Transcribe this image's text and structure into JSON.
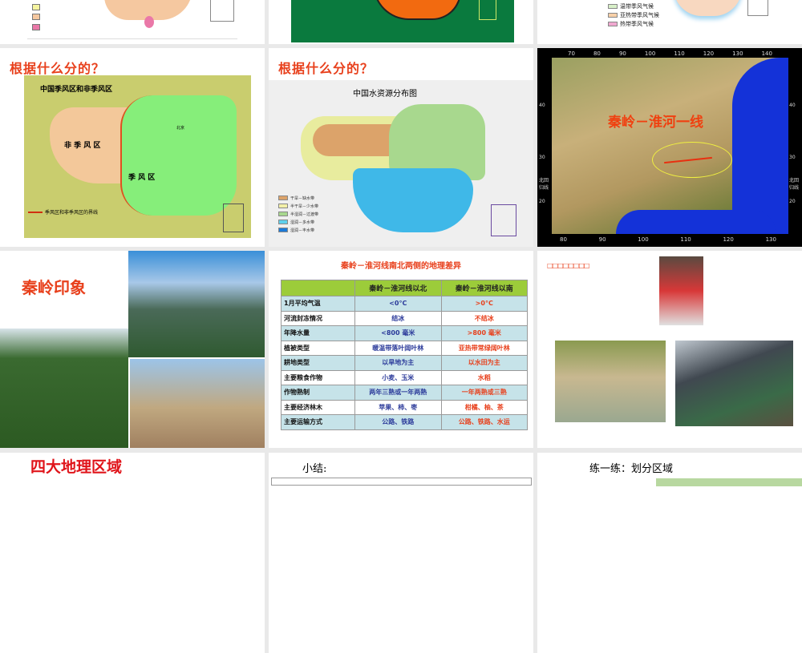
{
  "slides": [
    {
      "id": "climate-map",
      "legend": [
        "",
        "",
        "",
        ""
      ]
    },
    {
      "id": "orange-map"
    },
    {
      "id": "climate-types-map",
      "legend": [
        "温带季风气候",
        "亚热带季风气候",
        "热带季风气候"
      ]
    },
    {
      "id": "monsoon-map",
      "title": "根据什么分的？",
      "map_title": "中国季风区和非季风区",
      "region_non": "非 季 风 区",
      "region_mon": "季    风    区",
      "legend": "季风区和非季风区的界线",
      "capital": "北京"
    },
    {
      "id": "water-map",
      "title": "根据什么分的？",
      "map_title": "中国水资源分布图",
      "legend": [
        "干旱－缺水带",
        "半干旱－少水带",
        "半湿润－过渡带",
        "湿润－多水带",
        "湿润－丰水带"
      ]
    },
    {
      "id": "satellite-map",
      "label": "秦岭－淮河一线",
      "top_ticks": [
        "70",
        "80",
        "90",
        "100",
        "110",
        "120",
        "130",
        "140"
      ],
      "bottom_ticks": [
        "80",
        "90",
        "100",
        "110",
        "120",
        "130"
      ],
      "left_ticks": [
        "40",
        "30",
        "北回归线",
        "20"
      ],
      "right_ticks": [
        "40",
        "30",
        "北回归线",
        "20"
      ]
    },
    {
      "id": "qinling-impression",
      "title": "秦岭印象"
    },
    {
      "id": "differences-table",
      "title": "秦岭－淮河线南北两侧的地理差异",
      "headers": [
        "",
        "秦岭－淮河线以北",
        "秦岭－淮河线以南"
      ],
      "rows": [
        [
          "1月平均气温",
          "<0°C",
          ">0°C"
        ],
        [
          "河流封冻情况",
          "结冰",
          "不结冰"
        ],
        [
          "年降水量",
          "<800 毫米",
          ">800 毫米"
        ],
        [
          "植被类型",
          "暖温带落叶阔叶林",
          "亚热带常绿阔叶林"
        ],
        [
          "耕地类型",
          "以旱地为主",
          "以水田为主"
        ],
        [
          "主要粮食作物",
          "小麦、玉米",
          "水稻"
        ],
        [
          "作物熟制",
          "两年三熟或一年两熟",
          "一年两熟或三熟"
        ],
        [
          "主要经济林木",
          "苹果、柿、枣",
          "柑橘、柚、茶"
        ],
        [
          "主要运输方式",
          "公路、铁路",
          "公路、铁路、水运"
        ]
      ]
    },
    {
      "id": "pollution",
      "title": "□□□□□□□□"
    },
    {
      "id": "four-regions",
      "title": "四大地理区域"
    },
    {
      "id": "summary",
      "title": "小结:"
    },
    {
      "id": "practice",
      "title": "练一练：划分区域"
    }
  ],
  "colors": {
    "title_red": "#e8401c",
    "header_green": "#9ccc3a",
    "row_blue": "#c6e3e9"
  }
}
